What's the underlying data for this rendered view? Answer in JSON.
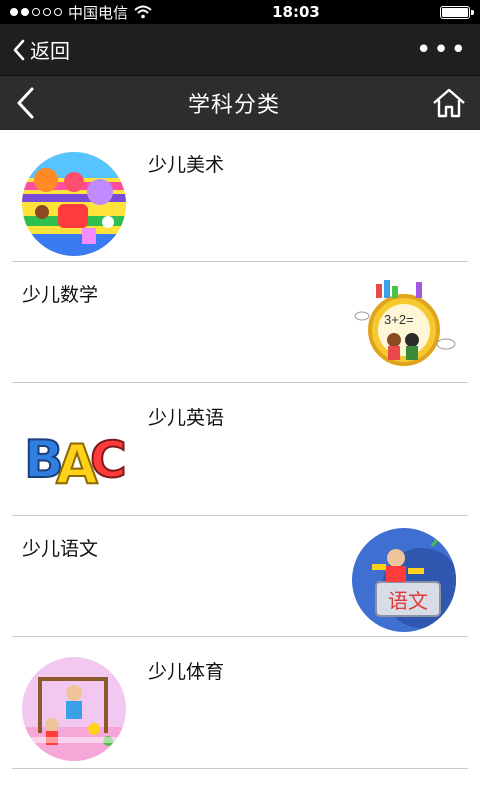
{
  "status_bar": {
    "carrier": "中国电信",
    "time": "18:03"
  },
  "wechat_bar": {
    "back_label": "返回",
    "more_label": "•••"
  },
  "header": {
    "title": "学科分类"
  },
  "categories": [
    {
      "label": "少儿美术",
      "icon": "art-class-thumbnail"
    },
    {
      "label": "少儿数学",
      "icon": "math-class-thumbnail"
    },
    {
      "label": "少儿英语",
      "icon": "english-class-thumbnail"
    },
    {
      "label": "少儿语文",
      "icon": "chinese-class-thumbnail"
    },
    {
      "label": "少儿体育",
      "icon": "pe-class-thumbnail"
    }
  ]
}
